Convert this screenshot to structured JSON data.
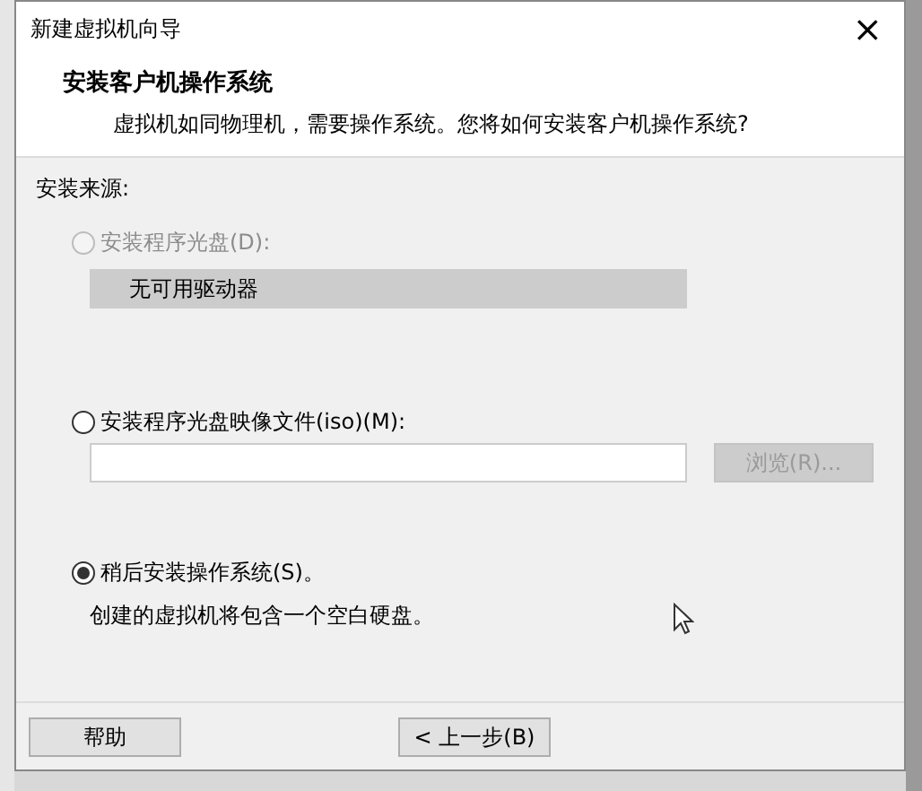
{
  "window": {
    "title": "新建虚拟机向导",
    "close": "×"
  },
  "header": {
    "title": "安装客户机操作系统",
    "subtitle": "虚拟机如同物理机，需要操作系统。您将如何安装客户机操作系统?"
  },
  "source_label": "安装来源:",
  "options": [
    {
      "kind": "drive",
      "label": "安装程序光盘(D):",
      "selected": false,
      "disabled": true,
      "dropdown": {
        "value": "无可用驱动器",
        "disabled": true
      }
    },
    {
      "kind": "iso",
      "label": "安装程序光盘映像文件(iso)(M):",
      "selected": false,
      "disabled": false,
      "browse": {
        "label": "浏览(R)...",
        "disabled": true
      }
    },
    {
      "kind": "later",
      "label": "稍后安装操作系统(S)。",
      "selected": true,
      "disabled": false,
      "note": "创建的虚拟机将包含一个空白硬盘。"
    }
  ],
  "buttons": [
    {
      "label": "帮助",
      "kind": "help"
    },
    {
      "label": "< 上一步(B)",
      "kind": "back"
    }
  ]
}
